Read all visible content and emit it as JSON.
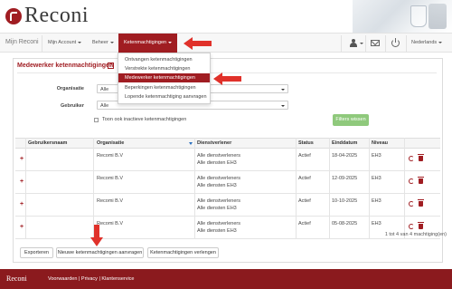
{
  "app": {
    "logo_text": "Reconi",
    "brand": "Mijn Reconi",
    "footer_brand": "Reconi"
  },
  "nav": {
    "items": [
      {
        "label": "Mijn Account"
      },
      {
        "label": "Beheer"
      },
      {
        "label": "Ketenmachtigingen"
      }
    ],
    "language": "Nederlands"
  },
  "dropdown": {
    "items": [
      {
        "label": "Ontvangen ketenmachtigingen"
      },
      {
        "label": "Verstrekte ketenmachtigingen"
      },
      {
        "label": "Medewerker ketenmachtigingen",
        "active": true
      },
      {
        "label": "Beperkingen ketenmachtigingen"
      },
      {
        "label": "Lopende ketenmachtiging aanvragen"
      }
    ]
  },
  "panel": {
    "title": "Medewerker ketenmachtigingen",
    "help": "?"
  },
  "filters": {
    "organisatie_label": "Organisatie",
    "organisatie_value": "Alle",
    "gebruiker_label": "Gebruiker",
    "gebruiker_value": "Alle",
    "inactive_label": "Toon ook inactieve ketenmachtigingen",
    "inactive_checked": false,
    "filter_button": "Filters wissen"
  },
  "table": {
    "headers": [
      "Gebruikersnaam",
      "Organisatie",
      "Dienstverlener",
      "Status",
      "Einddatum",
      "Niveau"
    ],
    "rows": [
      {
        "gebruikersnaam": "",
        "organisatie": "Recomi B.V",
        "dienstverlener_1": "Alle dienstverleners",
        "dienstverlener_2": "Alle diensten EH3",
        "status": "Actief",
        "einddatum": "18-04-2025",
        "niveau": "EH3"
      },
      {
        "gebruikersnaam": "",
        "organisatie": "Recomi B.V",
        "dienstverlener_1": "Alle dienstverleners",
        "dienstverlener_2": "Alle diensten EH3",
        "status": "Actief",
        "einddatum": "12-09-2025",
        "niveau": "EH3"
      },
      {
        "gebruikersnaam": "",
        "organisatie": "Recomi B.V",
        "dienstverlener_1": "Alle dienstverleners",
        "dienstverlener_2": "Alle diensten EH3",
        "status": "Actief",
        "einddatum": "10-10-2025",
        "niveau": "EH3"
      },
      {
        "gebruikersnaam": "",
        "organisatie": "Recomi B.V",
        "dienstverlener_1": "Alle dienstverleners",
        "dienstverlener_2": "Alle diensten EH3",
        "status": "Actief",
        "einddatum": "05-08-2025",
        "niveau": "EH3"
      }
    ],
    "count_text": "1 tot 4 van 4 machtiging(en)"
  },
  "actions": {
    "export": "Exporteren",
    "new_request": "Nieuwe ketenmachtigingen aanvragen",
    "extend": "Ketenmachtigingen verlengen"
  },
  "footer": {
    "links": "Voorwaarden | Privacy | Klantenservice"
  },
  "colors": {
    "brand_red": "#a01d22",
    "footer_red": "#8b1a1e",
    "filter_green": "#8fc97c",
    "arrow_red": "#e0312a"
  },
  "icons": [
    "user-icon",
    "mail-icon",
    "power-icon",
    "help-icon",
    "plus-icon",
    "renew-icon",
    "trash-icon",
    "sort-icon"
  ]
}
